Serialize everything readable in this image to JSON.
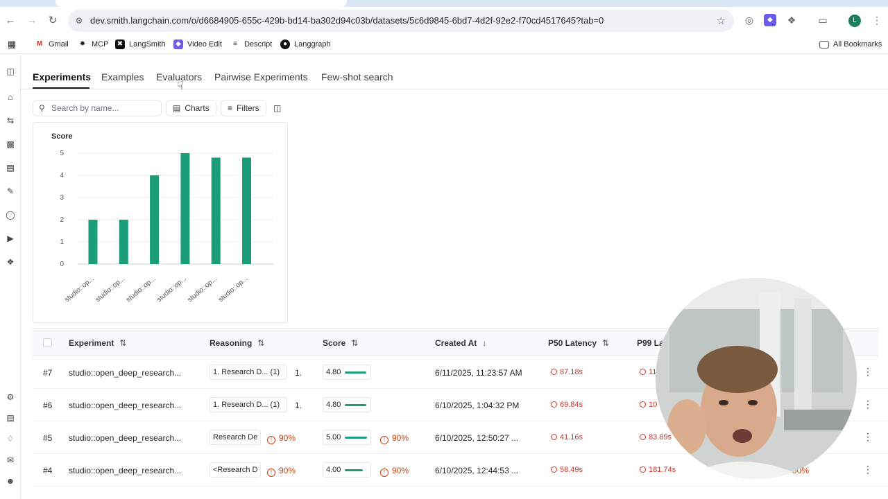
{
  "browser": {
    "url": "dev.smith.langchain.com/o/d6684905-655c-429b-bd14-ba302d94c03b/datasets/5c6d9845-6bd7-4d2f-92e2-f70cd4517645?tab=0",
    "profile_initial": "L",
    "bookmarks": [
      {
        "label": "Gmail",
        "icon": "gmail-icon"
      },
      {
        "label": "MCP",
        "icon": "mcp-icon"
      },
      {
        "label": "LangSmith",
        "icon": "langsmith-icon"
      },
      {
        "label": "Video Edit",
        "icon": "video-edit-icon"
      },
      {
        "label": "Descript",
        "icon": "descript-icon"
      },
      {
        "label": "Langgraph",
        "icon": "github-icon"
      }
    ],
    "all_bookmarks": "All Bookmarks"
  },
  "tabs": [
    "Experiments",
    "Examples",
    "Evaluators",
    "Pairwise Experiments",
    "Few-shot search"
  ],
  "active_tab": "Experiments",
  "toolbar": {
    "search_placeholder": "Search by name...",
    "charts_label": "Charts",
    "filters_label": "Filters"
  },
  "chart_data": {
    "type": "bar",
    "title": "Score",
    "categories": [
      "studio::op...",
      "studio::op...",
      "studio::op...",
      "studio::op...",
      "studio::op...",
      "studio::op..."
    ],
    "values": [
      2,
      2,
      4,
      5,
      4.8,
      4.8
    ],
    "ylim": [
      0,
      5
    ],
    "yticks": [
      0,
      1,
      2,
      3,
      4,
      5
    ],
    "color": "#1a9d78",
    "grid": true
  },
  "table": {
    "columns": [
      "Experiment",
      "Reasoning",
      "Score",
      "Created At",
      "P50 Latency",
      "P99 La"
    ],
    "rows": [
      {
        "id": "#7",
        "experiment": "studio::open_deep_research...",
        "reasoning": "1. Research D...",
        "reasoning_count": "(1)",
        "reasoning_extra": "1.",
        "score": "4.80",
        "score_frac": 0.96,
        "created": "6/11/2025, 11:23:57 AM",
        "p50": "87.18s",
        "p99": "11"
      },
      {
        "id": "#6",
        "experiment": "studio::open_deep_research...",
        "reasoning": "1. Research D...",
        "reasoning_count": "(1)",
        "reasoning_extra": "1.",
        "score": "4.80",
        "score_frac": 0.96,
        "created": "6/10/2025, 1:04:32 PM",
        "p50": "69.84s",
        "p99": "10"
      },
      {
        "id": "#5",
        "experiment": "studio::open_deep_research...",
        "reasoning": "Research De",
        "reasoning_pct": "90%",
        "score": "5.00",
        "score_frac": 1.0,
        "score_pct": "90%",
        "created": "6/10/2025, 12:50:27 ...",
        "p50": "41.16s",
        "p99": "83.89s"
      },
      {
        "id": "#4",
        "experiment": "studio::open_deep_research...",
        "reasoning": "<Research D",
        "reasoning_pct": "90%",
        "score": "4.00",
        "score_frac": 0.8,
        "score_pct": "90%",
        "created": "6/10/2025, 12:44:53 ...",
        "p50": "58.49s",
        "p99": "181.74s",
        "extra_pct": "90%"
      }
    ]
  }
}
